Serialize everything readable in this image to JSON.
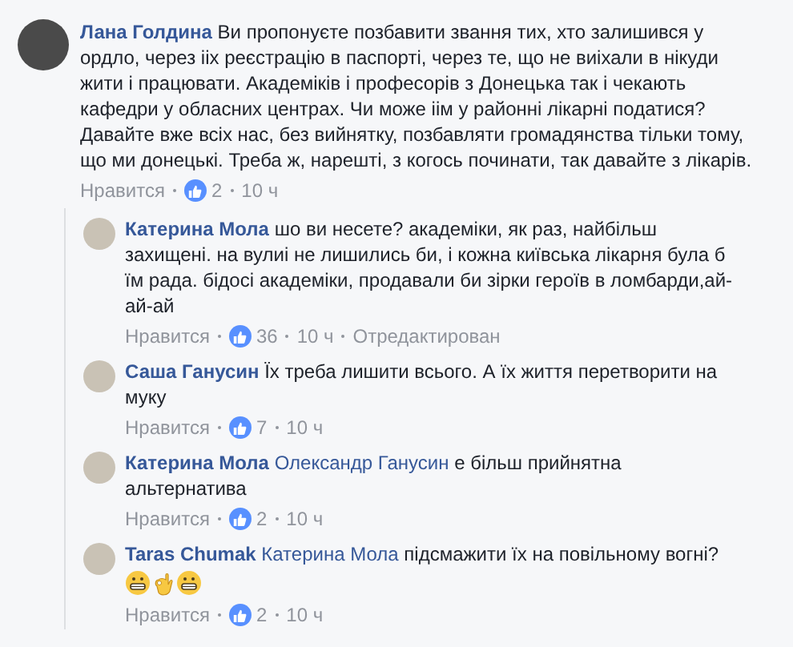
{
  "comments": [
    {
      "author": "Лана Голдина",
      "text": "Ви пропонуєте позбавити звання тих, хто залишився у ордло, через ііх реєстрацію в паспорті, через те, що не виіхали в нікуди жити і працювати. Академіків і професорів з Донецька так і чекають кафедри у обласних центрах. Чи може іім у районні лікарні податися? Давайте вже всіх нас, без вийнятку, позбавляти громадянства тільки тому, що ми донецькі. Треба ж, нарешті, з когось починати, так давайте з лікарів.",
      "like_label": "Нравится",
      "likes": "2",
      "time": "10 ч",
      "replies": [
        {
          "author": "Катерина Мола",
          "text": "шо ви несете? академіки, як раз, найбільш захищені. на вулиі не лишились би, і кожна київська лікарня була б їм рада. бідосі академіки, продавали би зірки героїв в ломбарди,ай-ай-ай",
          "like_label": "Нравится",
          "likes": "36",
          "time": "10 ч",
          "edited": "Отредактирован"
        },
        {
          "author": "Саша Ганусин",
          "text": "Їх треба лишити всього. А їх життя перетворити на муку",
          "like_label": "Нравится",
          "likes": "7",
          "time": "10 ч"
        },
        {
          "author": "Катерина Мола",
          "mention": "Олександр Ганусин",
          "text": "е більш прийнятна альтернатива",
          "like_label": "Нравится",
          "likes": "2",
          "time": "10 ч"
        },
        {
          "author": "Taras Chumak",
          "mention": "Катерина Мола",
          "text": "підсмажити їх на повільному вогні?",
          "emoji": true,
          "like_label": "Нравится",
          "likes": "2",
          "time": "10 ч"
        }
      ]
    }
  ]
}
